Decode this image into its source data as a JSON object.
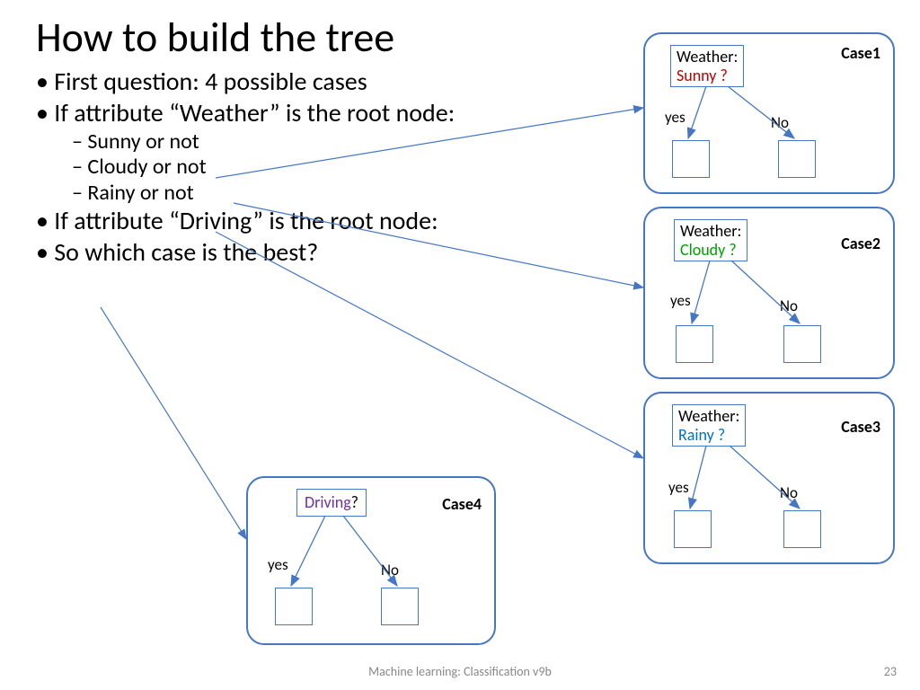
{
  "title": "How to build the tree",
  "bullets": [
    {
      "level": 1,
      "text": "First question: 4 possible cases"
    },
    {
      "level": 1,
      "text": "If attribute “Weather” is the root node:"
    },
    {
      "level": 2,
      "text": "Sunny or not"
    },
    {
      "level": 2,
      "text": "Cloudy or not"
    },
    {
      "level": 2,
      "text": "Rainy or not"
    },
    {
      "level": 1,
      "text": "If attribute “Driving” is the root node:"
    },
    {
      "level": 1,
      "text": "So which case is the best?"
    }
  ],
  "cases": {
    "case1": {
      "label": "Case1",
      "attr": "Weather:",
      "value": "Sunny ?",
      "value_color": "red",
      "yes": "yes",
      "no": "No"
    },
    "case2": {
      "label": "Case2",
      "attr": "Weather:",
      "value": "Cloudy ?",
      "value_color": "green",
      "yes": "yes",
      "no": "No"
    },
    "case3": {
      "label": "Case3",
      "attr": "Weather:",
      "value": "Rainy ?",
      "value_color": "blue",
      "yes": "yes",
      "no": "No"
    },
    "case4": {
      "label": "Case4",
      "attr": "Driving",
      "value": "?",
      "value_color": "purple",
      "yes": "yes",
      "no": "No"
    }
  },
  "footer": "Machine learning: Classification v9b",
  "page": "23"
}
